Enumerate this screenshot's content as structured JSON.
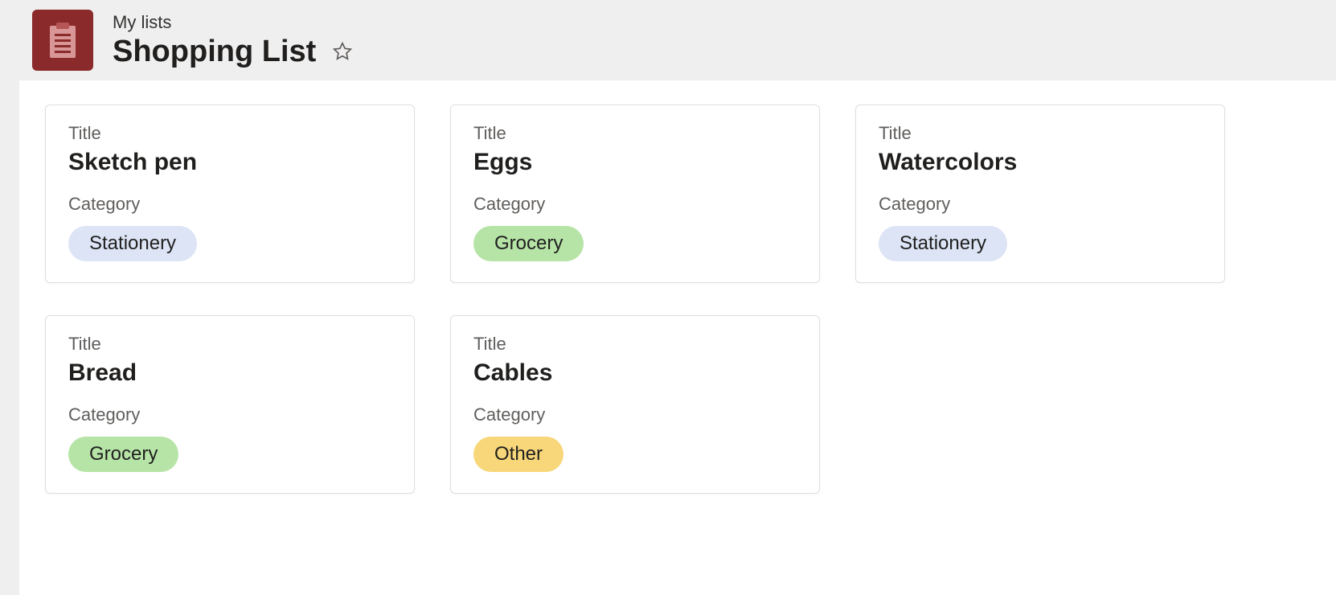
{
  "header": {
    "breadcrumb": "My lists",
    "title": "Shopping List"
  },
  "labels": {
    "title_field": "Title",
    "category_field": "Category"
  },
  "items": [
    {
      "title": "Sketch pen",
      "category": "Stationery"
    },
    {
      "title": "Eggs",
      "category": "Grocery"
    },
    {
      "title": "Watercolors",
      "category": "Stationery"
    },
    {
      "title": "Bread",
      "category": "Grocery"
    },
    {
      "title": "Cables",
      "category": "Other"
    }
  ]
}
